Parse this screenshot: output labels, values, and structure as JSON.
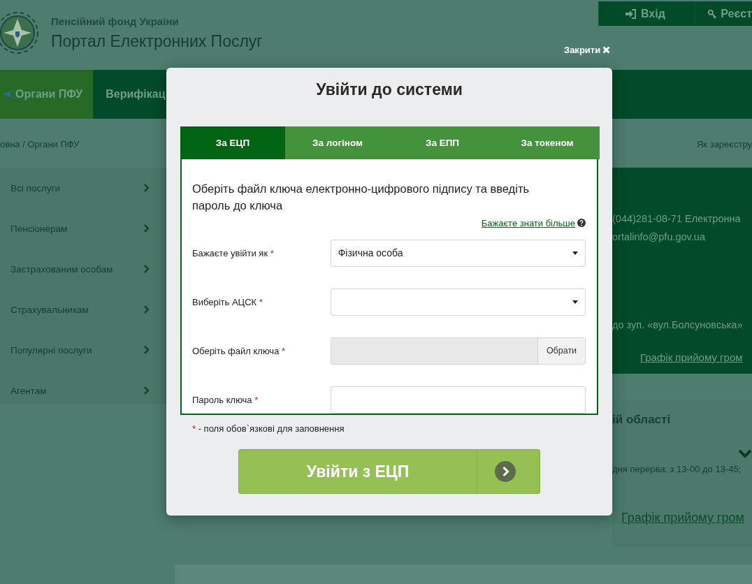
{
  "header": {
    "org": "Пенсійний фонд України",
    "title": "Портал Електронних Послуг",
    "account_buttons": [
      "Вхід",
      "Реєст"
    ]
  },
  "nav": [
    {
      "label": "Органи ПФУ",
      "selected": true
    },
    {
      "label": "Верифікац",
      "selected": false
    }
  ],
  "breadcrumb": "овна / Органи ПФУ",
  "help_link": "Як зареєстру",
  "sidebar": {
    "items": [
      "Всі послуги",
      "Пенсіонерам",
      "Застрахованим особам",
      "Страхувальникам",
      "Популярні послуги",
      "Агентам"
    ]
  },
  "contacts": {
    "lines": [
      "(044)281-08-71 Електронна",
      "ortalinfo@pfu.gov.ua",
      "до зуп. «вул.Болсуновська»"
    ],
    "link": "Графік прийому гром"
  },
  "region": {
    "title": "ій області",
    "hours": "дня перерва: з 13-00 до 13-45;",
    "link": "Графік прийому гром"
  },
  "modal": {
    "close": "Закрити",
    "title": "Увійти до системи",
    "tabs": [
      {
        "label": "За ЕЦП",
        "selected": true
      },
      {
        "label": "За логіном",
        "selected": false
      },
      {
        "label": "За ЕПП",
        "selected": false
      },
      {
        "label": "За токеном",
        "selected": false
      }
    ],
    "intro": "Оберіть файл ключа електронно-цифрового підпису та введіть пароль до ключа",
    "more_link": "Бажаєте знати більше",
    "required_mark": "*",
    "fields": [
      {
        "kind": "select",
        "label": "Бажаєте увійти як",
        "value": "Фізична особа",
        "required": true
      },
      {
        "kind": "select",
        "label": "Виберіть АЦСК",
        "required": true
      },
      {
        "kind": "file",
        "label": "Оберіть файл ключа",
        "button": "Обрати",
        "required": true
      },
      {
        "kind": "password",
        "label": "Пароль ключа",
        "required": true
      }
    ],
    "required_note": "- поля обов`язкові для заповнення",
    "submit": "Увійти з ЕЦП"
  }
}
